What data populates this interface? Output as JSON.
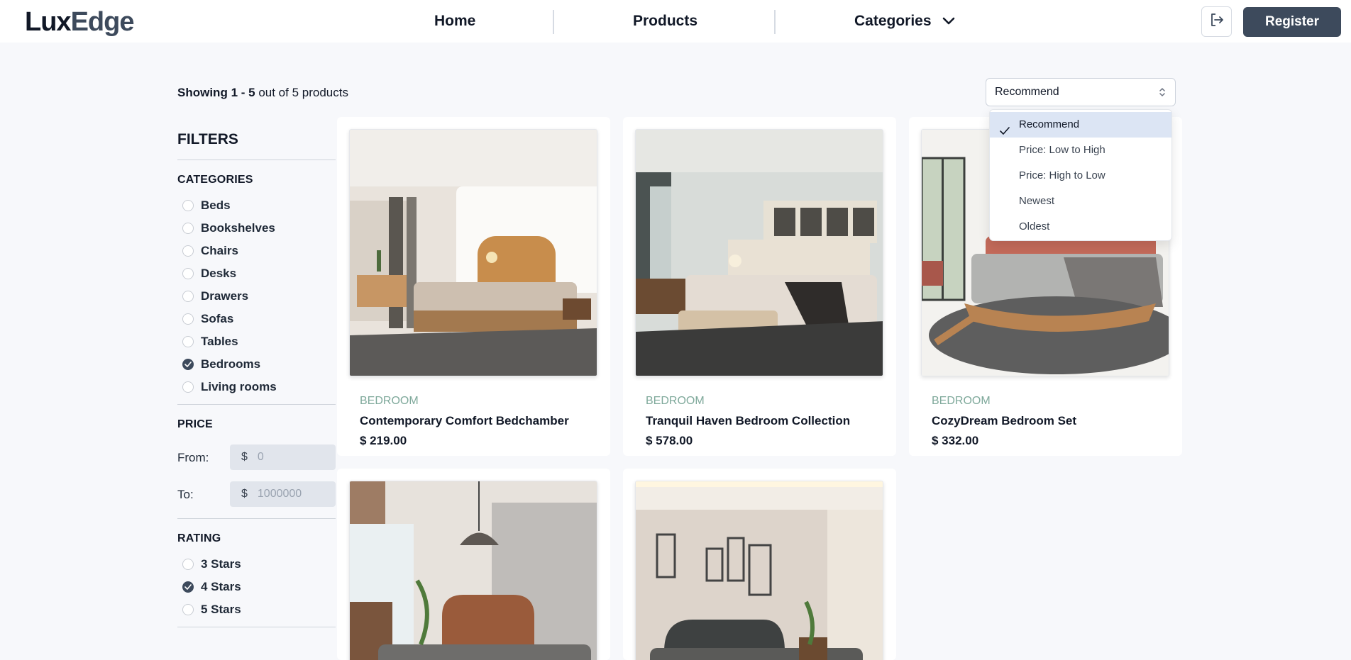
{
  "header": {
    "logo_part1": "Lux",
    "logo_part2": "Edge",
    "nav": {
      "home": "Home",
      "products": "Products",
      "categories": "Categories"
    },
    "register": "Register"
  },
  "listing": {
    "showing_prefix": "Showing",
    "showing_range": "1 - 5",
    "showing_suffix": "out of 5 products"
  },
  "sort": {
    "selected": "Recommend",
    "options": [
      "Recommend",
      "Price: Low to High",
      "Price: High to Low",
      "Newest",
      "Oldest"
    ]
  },
  "filters": {
    "title": "FILTERS",
    "categories_title": "CATEGORIES",
    "categories": [
      {
        "label": "Beds",
        "checked": false
      },
      {
        "label": "Bookshelves",
        "checked": false
      },
      {
        "label": "Chairs",
        "checked": false
      },
      {
        "label": "Desks",
        "checked": false
      },
      {
        "label": "Drawers",
        "checked": false
      },
      {
        "label": "Sofas",
        "checked": false
      },
      {
        "label": "Tables",
        "checked": false
      },
      {
        "label": "Bedrooms",
        "checked": true
      },
      {
        "label": "Living rooms",
        "checked": false
      }
    ],
    "price_title": "PRICE",
    "from_label": "From:",
    "to_label": "To:",
    "currency": "$",
    "from_placeholder": "0",
    "to_placeholder": "1000000",
    "rating_title": "RATING",
    "ratings": [
      {
        "label": "3 Stars",
        "checked": false
      },
      {
        "label": "4 Stars",
        "checked": true
      },
      {
        "label": "5 Stars",
        "checked": false
      }
    ]
  },
  "products": [
    {
      "category": "BEDROOM",
      "name": "Contemporary Comfort Bedchamber",
      "price": "$ 219.00"
    },
    {
      "category": "BEDROOM",
      "name": "Tranquil Haven Bedroom Collection",
      "price": "$ 578.00"
    },
    {
      "category": "BEDROOM",
      "name": "CozyDream Bedroom Set",
      "price": "$ 332.00"
    },
    {
      "category": "",
      "name": "",
      "price": ""
    },
    {
      "category": "",
      "name": "",
      "price": ""
    }
  ]
}
